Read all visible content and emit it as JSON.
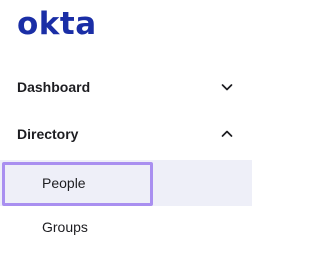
{
  "brand": {
    "name": "okta",
    "color": "#1a2ea6"
  },
  "nav": {
    "sections": [
      {
        "label": "Dashboard",
        "expanded": false,
        "icon": "chevron-down-icon"
      },
      {
        "label": "Directory",
        "expanded": true,
        "icon": "chevron-up-icon",
        "items": [
          {
            "label": "People",
            "selected": true,
            "focused": true
          },
          {
            "label": "Groups",
            "selected": false
          }
        ]
      }
    ]
  },
  "colors": {
    "text": "#1d1d21",
    "selected_background": "#eeeff8",
    "focus_ring": "#a98ff0"
  }
}
